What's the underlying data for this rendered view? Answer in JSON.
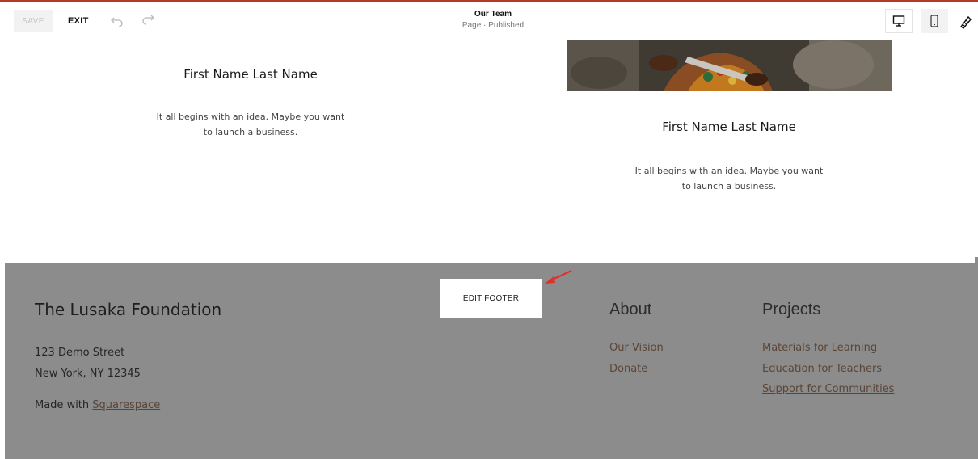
{
  "toolbar": {
    "save_label": "SAVE",
    "exit_label": "EXIT",
    "page_title": "Our Team",
    "page_status": "Page · Published",
    "icons": [
      "undo-icon",
      "redo-icon",
      "desktop-icon",
      "mobile-icon",
      "paintbrush-icon"
    ]
  },
  "team": {
    "left": {
      "name": "First Name Last Name",
      "bio_line1": "It all begins with an idea. Maybe you want",
      "bio_line2": "to launch a business."
    },
    "right": {
      "name": "First Name Last Name",
      "bio_line1": "It all begins with an idea. Maybe you want",
      "bio_line2": "to launch a business."
    }
  },
  "footer": {
    "edit_label": "EDIT FOOTER",
    "org_name": "The Lusaka Foundation",
    "address_line1": "123 Demo Street",
    "address_line2": "New York, NY 12345",
    "made_with_prefix": "Made with",
    "made_with_link": "Squarespace",
    "about": {
      "heading": "About",
      "links": [
        "Our Vision",
        "Donate"
      ]
    },
    "projects": {
      "heading": "Projects",
      "links": [
        "Materials for Learning",
        "Education for Teachers",
        "Support for Communities"
      ]
    }
  },
  "colors": {
    "footer_bg": "#8c8c8c",
    "link": "#5a4536",
    "accent_line": "#b23a2c",
    "annotation_arrow": "#e0302a"
  }
}
